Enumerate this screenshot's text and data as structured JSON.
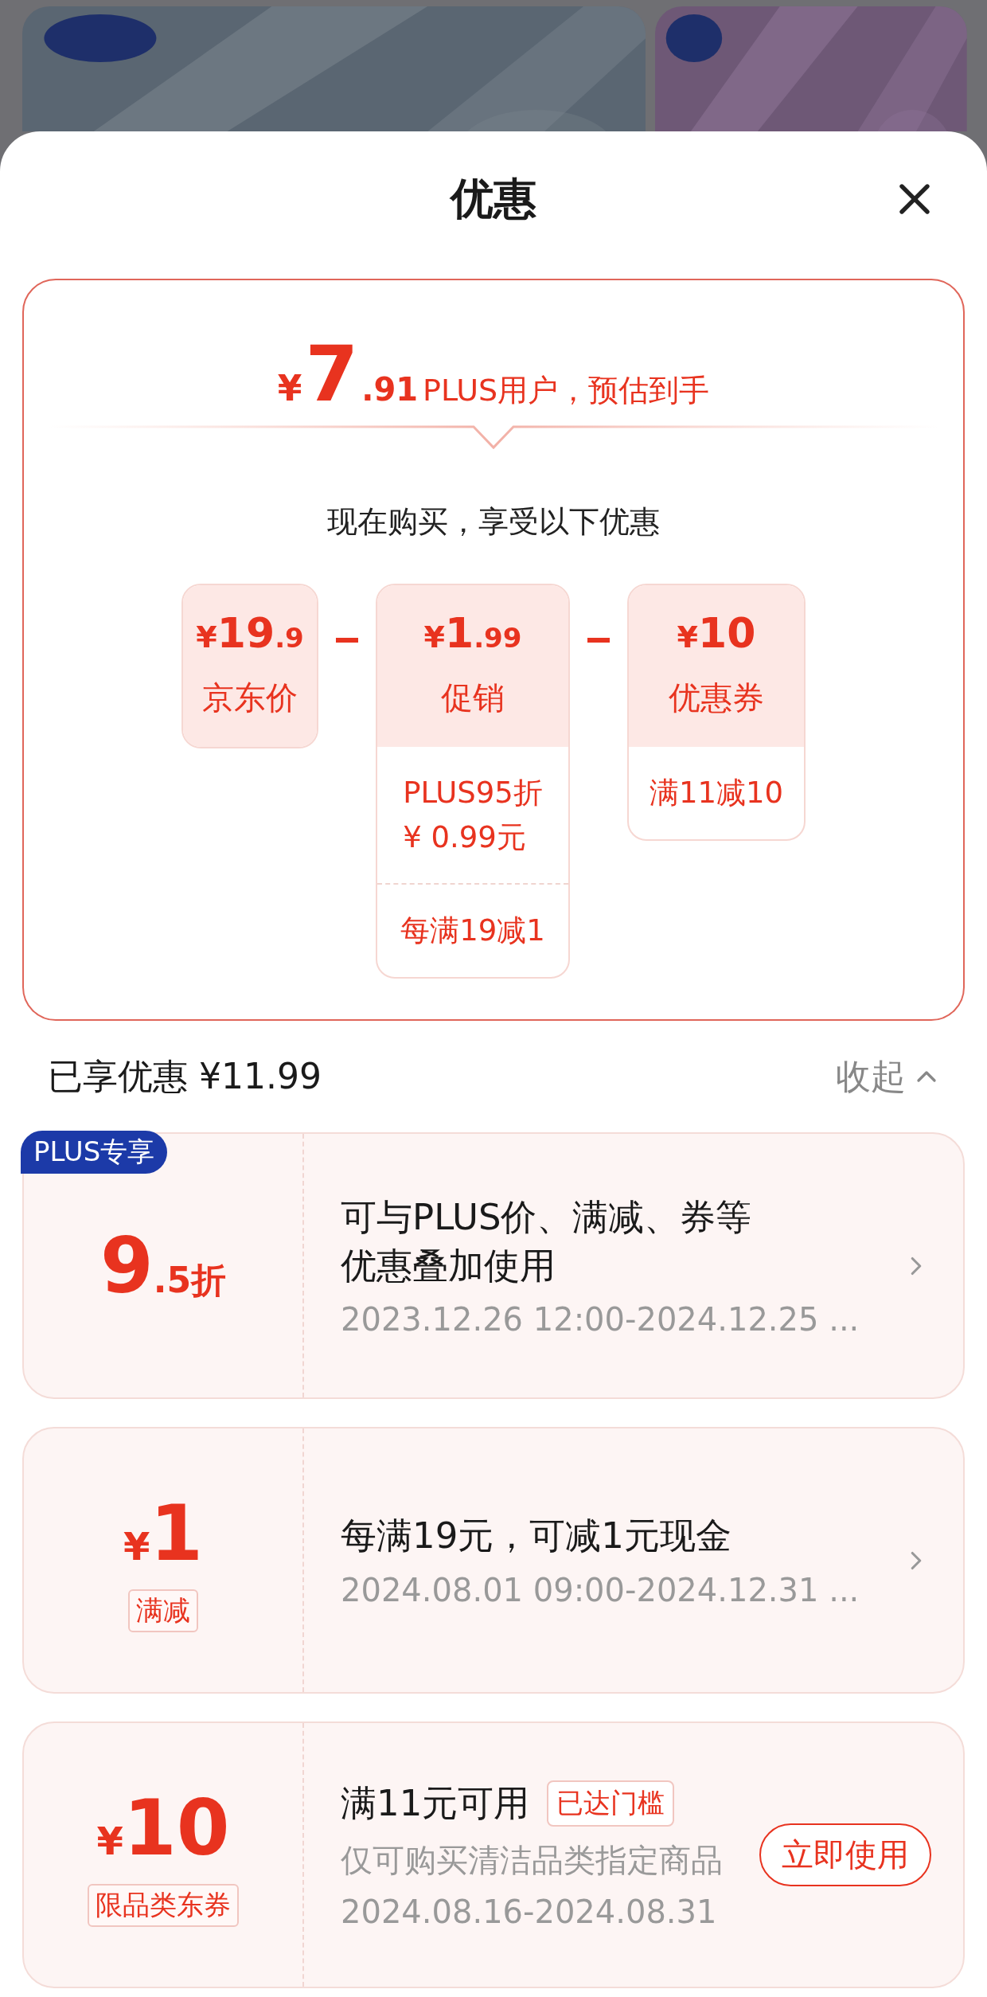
{
  "sheet": {
    "title": "优惠"
  },
  "summary": {
    "currency": "¥",
    "price_int": "7",
    "price_dec": ".91",
    "price_note": "PLUS用户，预估到手",
    "subtitle": "现在购买，享受以下优惠",
    "breakdown": [
      {
        "currency": "¥",
        "amount_int": "19",
        "amount_dec": ".9",
        "label": "京东价"
      },
      {
        "currency": "¥",
        "amount_int": "1",
        "amount_dec": ".99",
        "label": "促销",
        "details": [
          {
            "lines": [
              "PLUS95折",
              "¥ 0.99元"
            ]
          },
          {
            "lines": [
              "每满19减1"
            ]
          }
        ]
      },
      {
        "currency": "¥",
        "amount_int": "10",
        "label": "优惠券",
        "details": [
          {
            "lines": [
              "满11减10"
            ]
          }
        ]
      }
    ]
  },
  "saved": {
    "label": "已享优惠 ¥11.99",
    "toggle": "收起",
    "expanded": true
  },
  "offers": [
    {
      "badge": "PLUS专享",
      "value": "9",
      "suffix": ".5折",
      "title": [
        "可与PLUS价、满减、券等",
        "优惠叠加使用"
      ],
      "period": "2023.12.26 12:00-2024.12.25 ...",
      "action": {
        "kind": "chevron"
      }
    },
    {
      "prefix": "¥",
      "value": "1",
      "tag": "满减",
      "title": [
        "每满19元，可减1元现金"
      ],
      "period": "2024.08.01 09:00-2024.12.31 ...",
      "action": {
        "kind": "chevron"
      }
    },
    {
      "prefix": "¥",
      "value": "10",
      "tag": "限品类东券",
      "title": [
        "满11元可用"
      ],
      "status": "已达门槛",
      "description": "仅可购买清洁品类指定商品",
      "period": "2024.08.16-2024.08.31",
      "action": {
        "kind": "button",
        "label": "立即使用"
      }
    }
  ]
}
